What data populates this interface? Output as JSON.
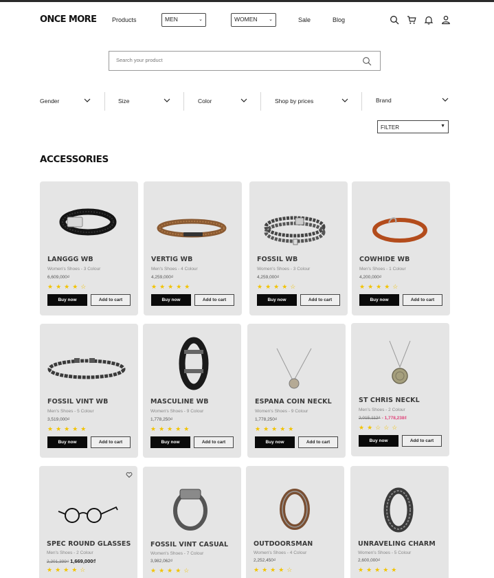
{
  "header": {
    "logo": "ONCE MORE",
    "nav": {
      "products": "Products",
      "men": "MEN",
      "women": "WOMEN",
      "sale": "Sale",
      "blog": "Blog"
    },
    "icons": [
      "search-icon",
      "cart-icon",
      "bell-icon",
      "user-icon"
    ]
  },
  "search": {
    "placeholder": "Search your product"
  },
  "filters": {
    "gender": "Gender",
    "size": "Size",
    "color": "Color",
    "prices": "Shop by prices",
    "brand": "Brand"
  },
  "filter_select": "FILTER",
  "section_title": "ACCESSORIES",
  "colors": {
    "star": "#f2c300",
    "sale_price": "#e0457b",
    "button": "#0a0a0a",
    "card": "#e5e5e5"
  },
  "buttons": {
    "buy": "Buy now",
    "cart": "Add to cart"
  },
  "products": [
    {
      "name": "LANGGG WB",
      "meta": "Women's Shoes - 3 Colour",
      "price": "6,609,000₫",
      "rating": 4.5
    },
    {
      "name": "VERTIG WB",
      "meta": "Men's Shoes - 4 Colour",
      "price": "4,259,000₫",
      "rating": 5
    },
    {
      "name": "FOSSIL  WB",
      "meta": "Women's Shoes - 3 Colour",
      "price": "4,259,000₫",
      "rating": 4.5
    },
    {
      "name": "COWHIDE WB",
      "meta": "Men's Shoes - 1 Colour",
      "price": "4,200,000₫",
      "rating": 4.5
    },
    {
      "name": "FOSSIL VINT WB",
      "meta": "Men's Shoes - 5 Colour",
      "price": "3,519,000₫",
      "rating": 5
    },
    {
      "name": "MASCULINE WB",
      "meta": "Women's Shoes - 9 Colour",
      "price": "1,778,250₫",
      "rating": 5
    },
    {
      "name": "ESPANA COIN NECKL",
      "meta": "Women's Shoes - 9 Colour",
      "price": "1,778,250₫",
      "rating": 5
    },
    {
      "name": "ST CHRIS NECKL",
      "meta": "Men's Shoes - 2 Colour",
      "old_price": "2,015,112₫",
      "new_price": "- 1,778,238₫",
      "rating": 2
    },
    {
      "name": "SPEC ROUND GLASSES",
      "meta": "Men's Shoes - 2 Colour",
      "old_price": "2,201,399₫",
      "new_price": "1,669,000₫",
      "rating": 4.5
    },
    {
      "name": "FOSSIL VINT CASUAL",
      "meta": "Women's Shoes - 7  Colour",
      "price": "3,982,062₫",
      "rating": 4.5
    },
    {
      "name": "OUTDOORSMAN",
      "meta": "Women's Shoes - 4 Colour",
      "price": "2,252,450₫",
      "rating": 4.5
    },
    {
      "name": "UNRAVELING CHARM",
      "meta": "Women's Shoes - 5 Colour",
      "price": "2,600,000₫",
      "rating": 5
    }
  ]
}
